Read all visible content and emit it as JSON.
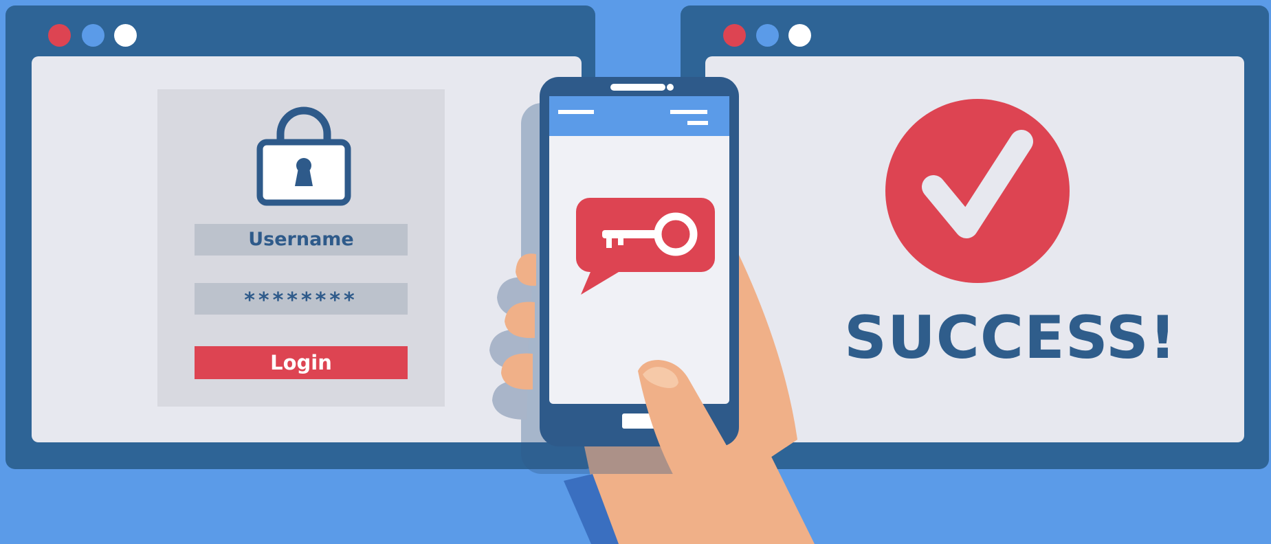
{
  "login_form": {
    "username_placeholder": "Username",
    "password_value": "********",
    "login_label": "Login"
  },
  "result": {
    "success_text": "SUCCESS!"
  },
  "icons": {
    "lock": "padlock-icon",
    "key": "key-message-icon",
    "check": "checkmark-icon"
  },
  "colors": {
    "background": "#5b9be8",
    "window": "#2e6496",
    "accent_red": "#dd4452",
    "panel": "#e7e8ef",
    "text_blue": "#2f5d8b"
  }
}
